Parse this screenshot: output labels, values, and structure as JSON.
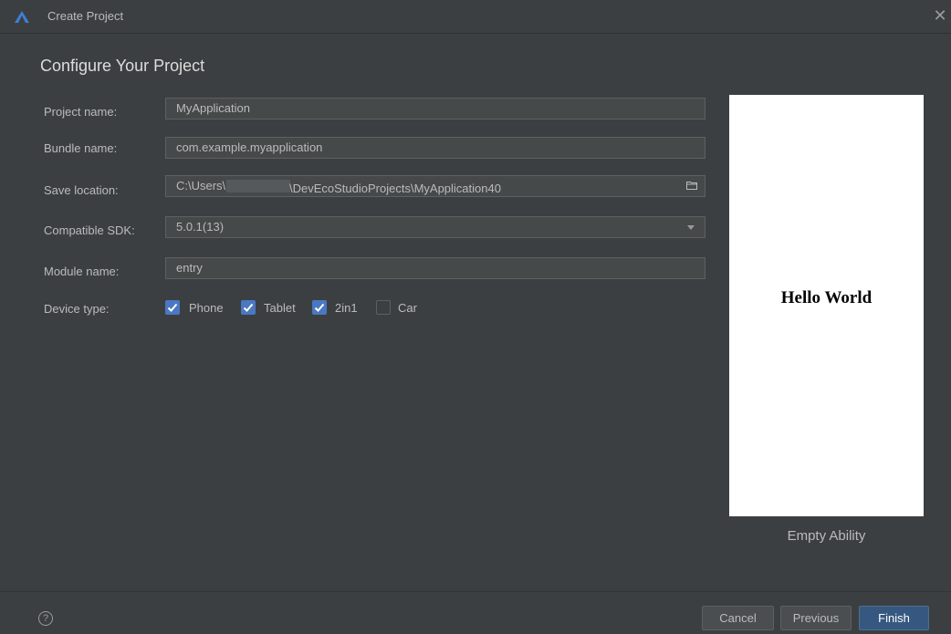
{
  "window": {
    "title": "Create Project",
    "app_icon": "deveco-logo-icon",
    "close_icon": "close-icon"
  },
  "heading": "Configure Your Project",
  "form": {
    "project_name": {
      "label": "Project name:",
      "value": "MyApplication"
    },
    "bundle_name": {
      "label": "Bundle name:",
      "value": "com.example.myapplication"
    },
    "save_location": {
      "label": "Save location:",
      "value_prefix": "C:\\Users\\",
      "value_suffix": "\\DevEcoStudioProjects\\MyApplication40"
    },
    "compatible_sdk": {
      "label": "Compatible SDK:",
      "value": "5.0.1(13)"
    },
    "module_name": {
      "label": "Module name:",
      "value": "entry"
    },
    "device_type": {
      "label": "Device type:",
      "options": [
        {
          "label": "Phone",
          "checked": true
        },
        {
          "label": "Tablet",
          "checked": true
        },
        {
          "label": "2in1",
          "checked": true
        },
        {
          "label": "Car",
          "checked": false
        }
      ]
    }
  },
  "preview": {
    "content_text": "Hello World",
    "template_name": "Empty Ability"
  },
  "footer": {
    "help_icon": "help-icon",
    "help_glyph": "?",
    "cancel_label": "Cancel",
    "previous_label": "Previous",
    "finish_label": "Finish"
  },
  "colors": {
    "background": "#3c3f41",
    "field_bg": "#45494a",
    "accent": "#4a78c2",
    "primary_button": "#365880"
  }
}
